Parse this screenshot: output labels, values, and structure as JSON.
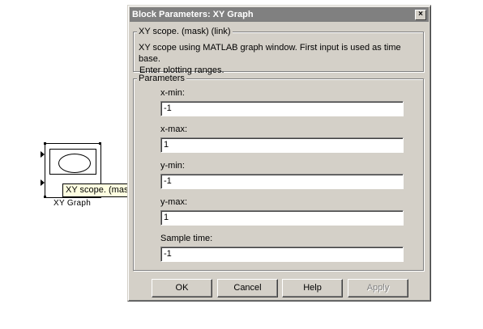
{
  "canvas": {
    "block_label": "XY Graph",
    "tooltip": "XY scope. (mask) (link)"
  },
  "dialog": {
    "title": "Block Parameters: XY Graph",
    "close_glyph": "×",
    "description_group": {
      "title": "XY scope. (mask) (link)",
      "line1": "XY scope using MATLAB graph window.  First input is used as time base.",
      "line2": "Enter plotting ranges."
    },
    "parameters_group": {
      "title": "Parameters",
      "fields": [
        {
          "label": "x-min:",
          "value": "-1"
        },
        {
          "label": "x-max:",
          "value": "1"
        },
        {
          "label": "y-min:",
          "value": "-1"
        },
        {
          "label": "y-max:",
          "value": "1"
        },
        {
          "label": "Sample time:",
          "value": "-1"
        }
      ]
    },
    "buttons": {
      "ok": "OK",
      "cancel": "Cancel",
      "help": "Help",
      "apply": "Apply"
    }
  }
}
